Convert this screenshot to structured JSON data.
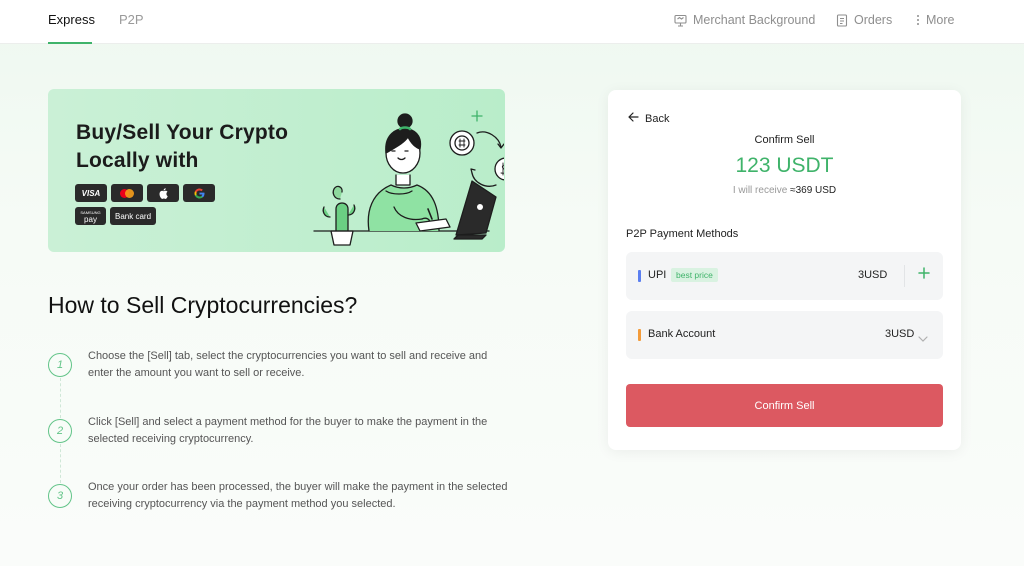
{
  "nav": {
    "tabs": [
      {
        "label": "Express",
        "active": true
      },
      {
        "label": "P2P",
        "active": false
      }
    ],
    "merchant_label": "Merchant Background",
    "orders_label": "Orders",
    "more_label": "More"
  },
  "banner": {
    "title": "Buy/Sell Your Crypto Locally with",
    "payment_badges": [
      "VISA",
      "mastercard",
      "apple-pay",
      "google-pay",
      "Samsung Pay",
      "Bank card"
    ],
    "samsung_small": "SAMSUNG",
    "samsung_label": "pay",
    "bank_card_label": "Bank card",
    "visa_label": "VISA"
  },
  "howto": {
    "title": "How to Sell Cryptocurrencies?",
    "steps": [
      {
        "num": "1",
        "text": "Choose the [Sell] tab, select the cryptocurrencies you want to sell and receive and enter the amount you want to sell or receive."
      },
      {
        "num": "2",
        "text": "Click [Sell] and select a payment method for the buyer to make the payment in the selected receiving cryptocurrency."
      },
      {
        "num": "3",
        "text": "Once your order has been processed, the buyer will make the payment in the selected receiving cryptocurrency via the payment method you selected."
      }
    ]
  },
  "card": {
    "back_label": "Back",
    "confirm_label": "Confirm Sell",
    "amount": "123 USDT",
    "receive_prefix": "I will receive",
    "receive_value": "≈369 USD",
    "methods_label": "P2P Payment Methods",
    "methods": [
      {
        "name": "UPI",
        "tag": "best price",
        "price": "3USD",
        "color": "#5b7ff0"
      },
      {
        "name": "Bank Account",
        "price": "3USD",
        "color": "#f39b3a"
      }
    ],
    "confirm_button": "Confirm Sell"
  },
  "colors": {
    "accent_green": "#3fb36a",
    "confirm_red": "#dc5961"
  }
}
